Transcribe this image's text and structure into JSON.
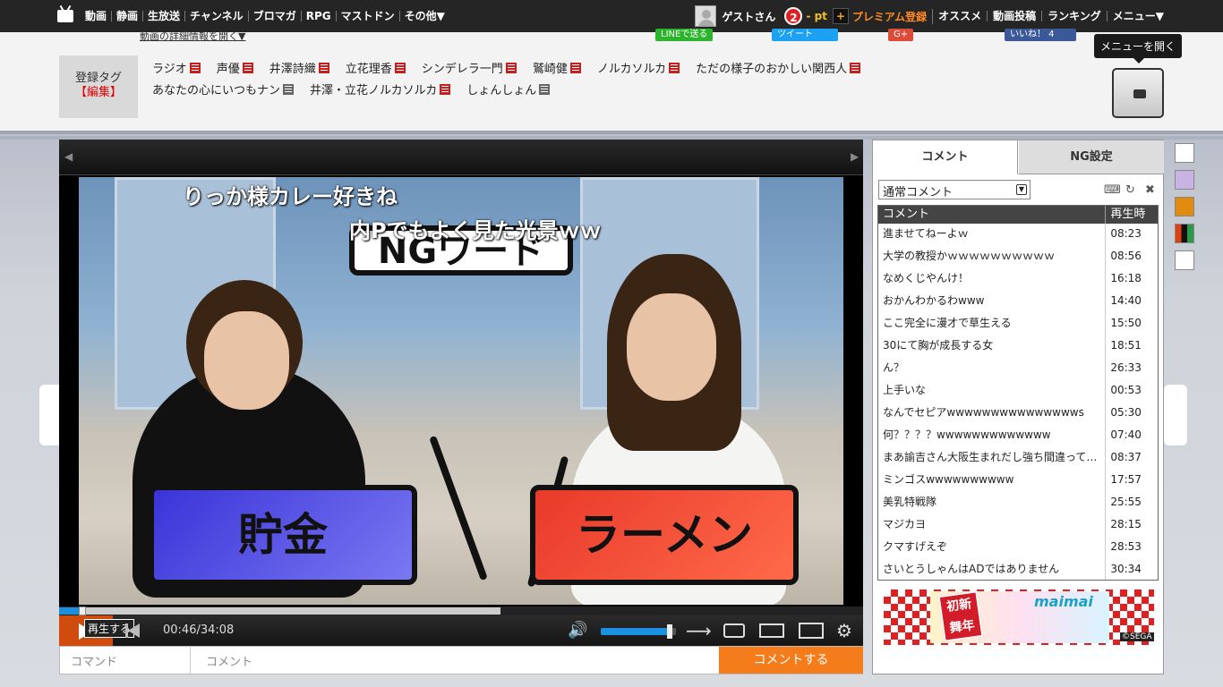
{
  "topbar": {
    "nav": [
      "動画",
      "静画",
      "生放送",
      "チャンネル",
      "ブロマガ",
      "RPG",
      "マストドン",
      "その他▼"
    ],
    "guest": "ゲストさん",
    "notif_count": "2",
    "points": "- pt",
    "premium_icon": "+",
    "premium": "プレミアム登録",
    "right_nav": [
      "オススメ",
      "動画投稿",
      "ランキング",
      "メニュー▼"
    ]
  },
  "tagarea": {
    "cut_link": "動画の詳細情報を開く▼",
    "share_line": "LINEで送る",
    "share_tweet": "ツイート",
    "share_gplus": "G+",
    "share_fb": "いいね！ 4",
    "label": "登録タグ",
    "edit": "【編集】",
    "row1": [
      "ラジオ",
      "声優",
      "井澤詩織",
      "立花理香",
      "シンデレラ一門",
      "鷲崎健",
      "ノルカソルカ",
      "ただの様子のおかしい関西人"
    ],
    "row2": [
      "あなたの心にいつもナン",
      "井澤・立花ノルカソルカ",
      "しょんしょん"
    ],
    "tooltip": "メニューを開く"
  },
  "player": {
    "flow_comments": [
      "りっか様カレー好きね",
      "NGワード",
      "内Pでもよく見た光景ｗｗ"
    ],
    "ng_word": "NGワード",
    "card_left": "貯金",
    "card_right": "ラーメン",
    "progress_played": 0.024,
    "progress_buffered": 0.549,
    "replay_tip": "再生する",
    "time": "00:46/34:08",
    "volume": 0.95,
    "command_placeholder": "コマンド",
    "comment_placeholder": "コメント",
    "submit": "コメントする"
  },
  "panel": {
    "tab_comment": "コメント",
    "tab_ng": "NG設定",
    "select": "通常コメント",
    "col_comment": "コメント",
    "col_time": "再生時",
    "rows": [
      {
        "text": "進ませてねーよｗ",
        "time": "08:23"
      },
      {
        "text": "大学の教授かｗｗｗｗｗｗｗｗｗｗ",
        "time": "08:56"
      },
      {
        "text": "なめくじやんけ！",
        "time": "16:18"
      },
      {
        "text": "おかんわかるわwww",
        "time": "14:40"
      },
      {
        "text": "ここ完全に漫才で草生える",
        "time": "15:50"
      },
      {
        "text": "30にて胸が成長する女",
        "time": "18:51"
      },
      {
        "text": "ん？",
        "time": "26:33"
      },
      {
        "text": "上手いな",
        "time": "00:53"
      },
      {
        "text": "なんでセピアwwwwwwwwwwwwwwws",
        "time": "05:30"
      },
      {
        "text": "何？？？？wwwwwwwwwwwww",
        "time": "07:40"
      },
      {
        "text": "まあ諭吉さん大阪生まれだし強ち間違ってない",
        "time": "08:37"
      },
      {
        "text": "ミンゴスwwwwwwwwww",
        "time": "17:57"
      },
      {
        "text": "美乳特戦隊",
        "time": "25:55"
      },
      {
        "text": "マジカヨ",
        "time": "28:15"
      },
      {
        "text": "クマすげえぞ",
        "time": "28:53"
      },
      {
        "text": "さいとうしゃんはADではありません",
        "time": "30:34"
      }
    ],
    "ad_title": "初新舞年",
    "ad_logo": "maimai",
    "ad_sega": "©SEGA"
  },
  "colors": {
    "accent_orange": "#f47c1b",
    "progress_blue": "#1b8fe0",
    "topbar": "#252525"
  }
}
